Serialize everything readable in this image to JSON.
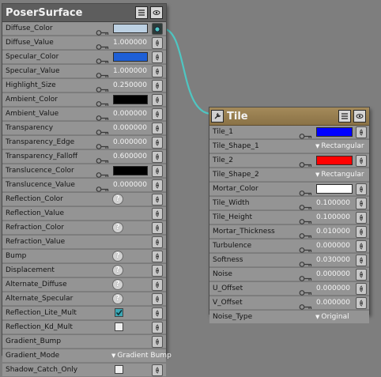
{
  "colors": {
    "wire": "#4fc6c2",
    "diffuse_color": "#bcd0e2",
    "specular_color": "#1e5fd6",
    "ambient_color": "#000000",
    "translucence_color": "#000000",
    "tile_1": "#0000ff",
    "tile_2": "#ff0000",
    "mortar_color": "#ffffff"
  },
  "poser_surface": {
    "title": "PoserSurface",
    "rows": [
      {
        "label": "Diffuse_Color",
        "kind": "swatch",
        "color": "#bcd0e2",
        "connected": true
      },
      {
        "label": "Diffuse_Value",
        "kind": "value",
        "value": "1.000000"
      },
      {
        "label": "Specular_Color",
        "kind": "swatch",
        "color": "#1e5fd6"
      },
      {
        "label": "Specular_Value",
        "kind": "value",
        "value": "1.000000"
      },
      {
        "label": "Highlight_Size",
        "kind": "value",
        "value": "0.250000"
      },
      {
        "label": "Ambient_Color",
        "kind": "swatch",
        "color": "#000000"
      },
      {
        "label": "Ambient_Value",
        "kind": "value",
        "value": "0.000000"
      },
      {
        "label": "Transparency",
        "kind": "value",
        "value": "0.000000"
      },
      {
        "label": "Transparency_Edge",
        "kind": "value",
        "value": "0.000000"
      },
      {
        "label": "Transparency_Falloff",
        "kind": "value",
        "value": "0.600000"
      },
      {
        "label": "Translucence_Color",
        "kind": "swatch",
        "color": "#000000"
      },
      {
        "label": "Translucence_Value",
        "kind": "value",
        "value": "0.000000"
      },
      {
        "label": "Reflection_Color",
        "kind": "help"
      },
      {
        "label": "Reflection_Value",
        "kind": "plug"
      },
      {
        "label": "Refraction_Color",
        "kind": "help"
      },
      {
        "label": "Refraction_Value",
        "kind": "plug"
      },
      {
        "label": "Bump",
        "kind": "help"
      },
      {
        "label": "Displacement",
        "kind": "help"
      },
      {
        "label": "Alternate_Diffuse",
        "kind": "help"
      },
      {
        "label": "Alternate_Specular",
        "kind": "help"
      },
      {
        "label": "Reflection_Lite_Mult",
        "kind": "checkbox",
        "checked": true
      },
      {
        "label": "Reflection_Kd_Mult",
        "kind": "checkbox",
        "checked": false
      },
      {
        "label": "Gradient_Bump",
        "kind": "plug"
      },
      {
        "label": "Gradient_Mode",
        "kind": "dropdown",
        "value": "Gradient Bump"
      },
      {
        "label": "Shadow_Catch_Only",
        "kind": "checkbox",
        "checked": false
      }
    ]
  },
  "tile": {
    "title": "Tile",
    "rows": [
      {
        "label": "Tile_1",
        "kind": "swatch",
        "color": "#0000ff"
      },
      {
        "label": "Tile_Shape_1",
        "kind": "dropdown",
        "value": "Rectangular"
      },
      {
        "label": "Tile_2",
        "kind": "swatch",
        "color": "#ff0000"
      },
      {
        "label": "Tile_Shape_2",
        "kind": "dropdown",
        "value": "Rectangular"
      },
      {
        "label": "Mortar_Color",
        "kind": "swatch",
        "color": "#ffffff"
      },
      {
        "label": "Tile_Width",
        "kind": "value",
        "value": "0.100000"
      },
      {
        "label": "Tile_Height",
        "kind": "value",
        "value": "0.100000"
      },
      {
        "label": "Mortar_Thickness",
        "kind": "value",
        "value": "0.010000"
      },
      {
        "label": "Turbulence",
        "kind": "value",
        "value": "0.000000"
      },
      {
        "label": "Softness",
        "kind": "value",
        "value": "0.030000"
      },
      {
        "label": "Noise",
        "kind": "value",
        "value": "0.000000"
      },
      {
        "label": "U_Offset",
        "kind": "value",
        "value": "0.000000"
      },
      {
        "label": "V_Offset",
        "kind": "value",
        "value": "0.000000"
      },
      {
        "label": "Noise_Type",
        "kind": "dropdown",
        "value": "Original"
      }
    ]
  }
}
